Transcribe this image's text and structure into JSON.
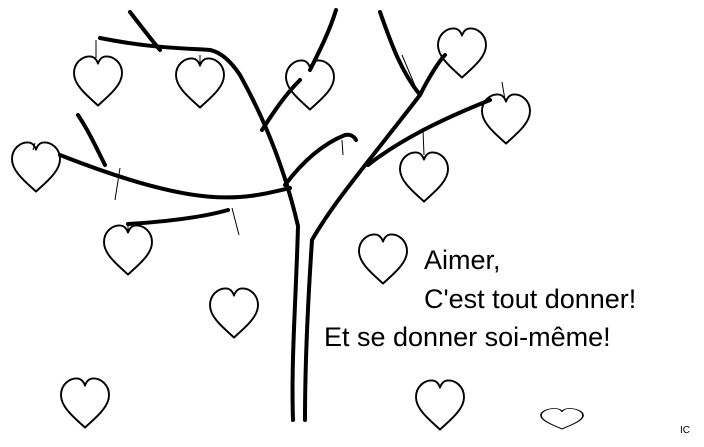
{
  "poem": {
    "line1": "Aimer,",
    "line2": "C'est tout donner!",
    "line3": "Et se donner soi-même!"
  },
  "signature": "IC",
  "colors": {
    "background": "#ffffff",
    "ink": "#000000"
  },
  "icons": [
    "heart-icon",
    "tree-drawing"
  ]
}
